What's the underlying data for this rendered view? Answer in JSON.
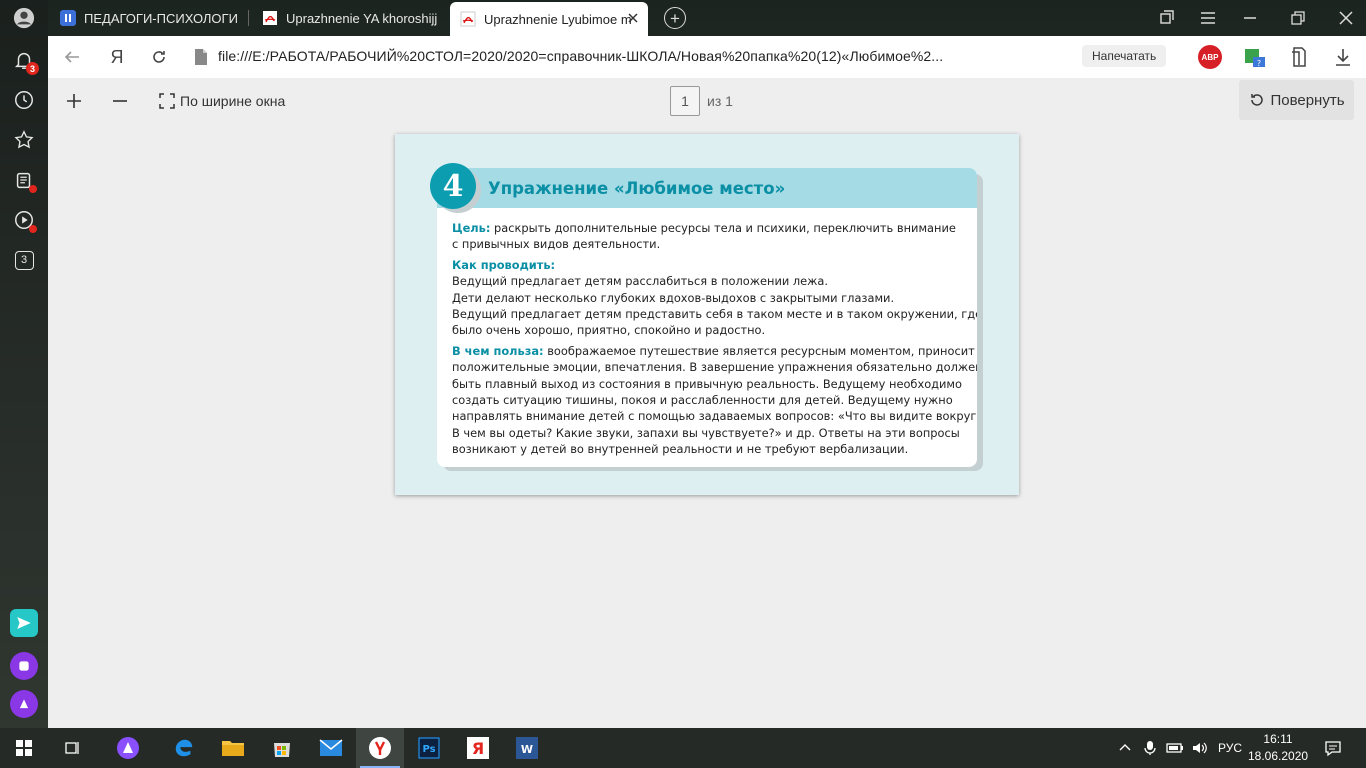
{
  "sidebar": {
    "notifications_badge": "3",
    "collections_label": "3"
  },
  "tabs": [
    {
      "label": "ПЕДАГОГИ-ПСИХОЛОГИ",
      "icon": "bookmark-app-icon"
    },
    {
      "label": "Uprazhnenie YA khoroshijj",
      "icon": "pdf-icon"
    },
    {
      "label": "Uprazhnenie Lyubimoe m",
      "icon": "pdf-icon",
      "active": true
    }
  ],
  "addressbar": {
    "yandex_logo": "Я",
    "url": "file:///E:/РАБОТА/РАБОЧИЙ%20СТОЛ=2020/2020=справочник-ШКОЛА/Новая%20папка%20(12)«Любимое%2...",
    "print_label": "Напечатать",
    "abp_label": "ABP"
  },
  "pdf_toolbar": {
    "fit_label": "По ширине окна",
    "page_current": "1",
    "page_of": "из 1",
    "rotate_label": "Повернуть"
  },
  "card": {
    "number": "4",
    "title": "Упражнение «Любимое место»",
    "goal_label": "Цель:",
    "goal_text_1": " раскрыть дополнительные ресурсы тела и психики, переключить внимание",
    "goal_text_2": "с привычных видов деятельности.",
    "how_label": "Как проводить:",
    "how_lines": [
      "Ведущий предлагает детям расслабиться в положении лежа.",
      "Дети делают несколько глубоких вдохов-выдохов с закрытыми глазами.",
      "Ведущий предлагает детям представить себя в таком месте и в таком окружении, где",
      "было очень хорошо, приятно, спокойно и радостно."
    ],
    "benefit_label": "В чем польза:",
    "benefit_first": " воображаемое путешествие является ресурсным моментом, приносит",
    "benefit_lines": [
      "положительные эмоции, впечатления. В завершение упражнения обязательно должен",
      "быть плавный выход из состояния в привычную реальность. Ведущему необходимо",
      "создать ситуацию тишины, покоя и расслабленности для детей. Ведущему нужно",
      "направлять внимание детей с помощью задаваемых вопросов: «Что вы видите вокруг?",
      "В чем вы одеты? Какие звуки, запахи вы чувствуете?» и др. Ответы на эти вопросы",
      "возникают у детей во внутренней реальности и не требуют вербализации."
    ]
  },
  "taskbar": {
    "language": "РУС",
    "time": "16:11",
    "date": "18.06.2020"
  },
  "colors": {
    "accent_teal": "#0a8fa5",
    "header_band": "#a5dbe5",
    "page_bg": "#deeff2"
  }
}
